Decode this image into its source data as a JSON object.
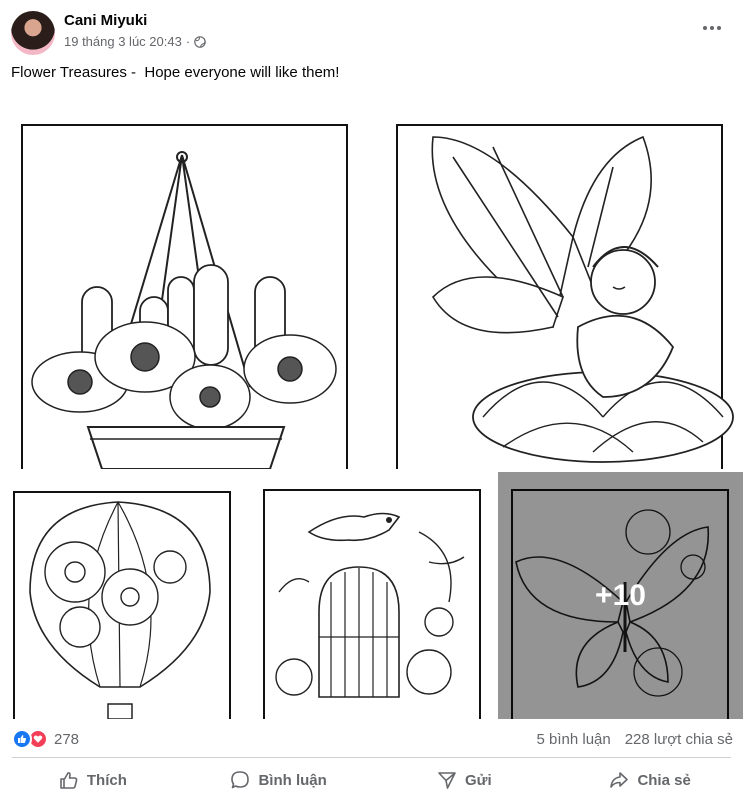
{
  "post": {
    "author": "Cani Miyuki",
    "timestamp": "19 tháng 3 lúc 20:43",
    "separator": "·",
    "privacy_icon": "globe-icon",
    "caption": "Flower Treasures -  Hope everyone will like them!"
  },
  "gallery": {
    "photos": [
      {
        "subject": "hanging-cactus-basket"
      },
      {
        "subject": "flower-fairy"
      },
      {
        "subject": "flower-hot-air-balloon"
      },
      {
        "subject": "bird-on-birdcage"
      },
      {
        "subject": "butterfly-flowers"
      }
    ],
    "more_count": "+10"
  },
  "stats": {
    "reaction_icons": [
      "like-icon",
      "love-icon"
    ],
    "reaction_count": "278",
    "comments": "5 bình luận",
    "shares": "228 lượt chia sẻ"
  },
  "actions": {
    "like": "Thích",
    "comment": "Bình luận",
    "send": "Gửi",
    "share": "Chia sẻ"
  },
  "colors": {
    "like_blue": "#1877f2",
    "love_red": "#f33e58",
    "secondary_text": "#65676b"
  }
}
